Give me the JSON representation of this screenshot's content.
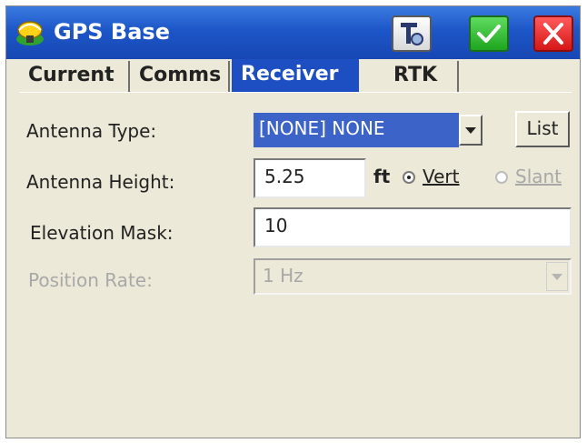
{
  "window": {
    "title": "GPS Base",
    "icons": {
      "app": "gps-satellite-icon",
      "tool": "rover-tool-icon",
      "ok": "checkmark-icon",
      "close": "close-x-icon"
    },
    "colors": {
      "titlebar": "#1d56c8",
      "active_tab": "#1e4fc2",
      "ok": "#1fa51f",
      "close": "#d61616"
    }
  },
  "tabs": [
    {
      "label": "Current",
      "active": false
    },
    {
      "label": "Comms",
      "active": false
    },
    {
      "label": "Receiver",
      "active": true
    },
    {
      "label": "RTK",
      "active": false
    }
  ],
  "form": {
    "antenna_type": {
      "label": "Antenna Type:",
      "value": "[NONE] NONE",
      "list_button": "List"
    },
    "antenna_height": {
      "label": "Antenna Height:",
      "value": "5.25",
      "unit": "ft",
      "vert_label": "Vert",
      "slant_label": "Slant",
      "selected": "Vert"
    },
    "elevation_mask": {
      "label": "Elevation Mask:",
      "value": "10"
    },
    "position_rate": {
      "label": "Position Rate:",
      "value": "1 Hz",
      "disabled": true
    }
  }
}
